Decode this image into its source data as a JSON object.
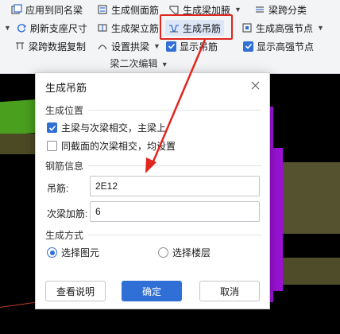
{
  "ribbon": {
    "row1": {
      "apply_same_name": "应用到同名梁",
      "gen_side_rebar": "生成侧面筋",
      "gen_beam_haunch": "生成梁加腋",
      "span_classify": "梁跨分类"
    },
    "row2": {
      "refresh_support": "刷新支座尺寸",
      "gen_stirrup_bar": "生成架立筋",
      "gen_hanger_bar": "生成吊筋",
      "gen_height_node": "生成高强节点"
    },
    "row3": {
      "copy_span_data": "梁跨数据复制",
      "set_arch_beam": "设置拱梁",
      "show_hanger": "显示吊筋",
      "show_height_node": "显示高强节点"
    },
    "group_label": "梁二次编辑"
  },
  "dialog": {
    "title": "生成吊筋",
    "section_position": "生成位置",
    "opt_main_secondary": "主梁与次梁相交，主梁上",
    "opt_same_section": "同截面的次梁相交，均设置",
    "section_rebar": "钢筋信息",
    "hanger_label": "吊筋:",
    "hanger_value": "2E12",
    "secondary_label": "次梁加筋:",
    "secondary_value": "6",
    "section_method": "生成方式",
    "radio_pick_element": "选择图元",
    "radio_pick_floor": "选择楼层",
    "btn_help": "查看说明",
    "btn_ok": "确定",
    "btn_cancel": "取消"
  },
  "colors": {
    "accent": "#2f6fd6",
    "highlight_box": "#e0261f",
    "arrow": "#e0261f"
  }
}
